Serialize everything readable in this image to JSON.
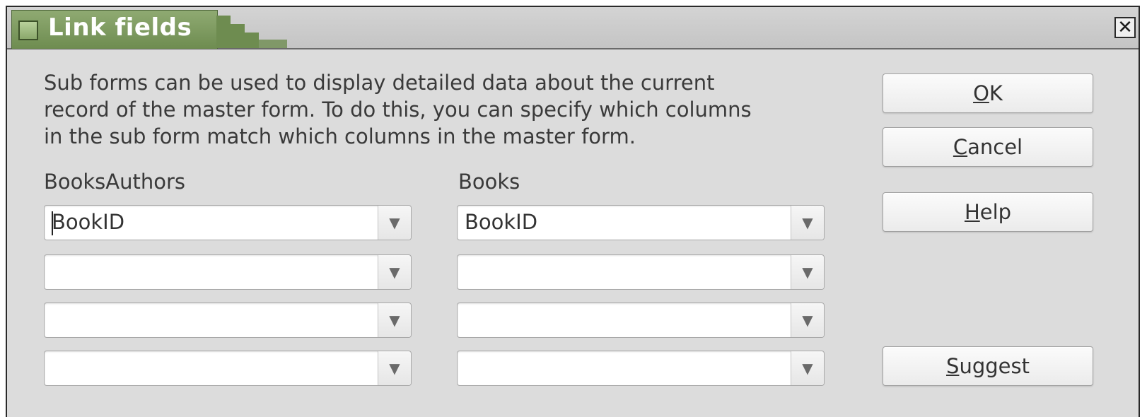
{
  "window": {
    "title": "Link fields",
    "close_glyph": "✕",
    "title_color": "#6e8c50"
  },
  "description": "Sub forms can be used to display detailed data about the current\nrecord of the master form. To do this, you can specify which columns\nin the sub form match which columns in the master form.",
  "columns": {
    "left_label": "BooksAuthors",
    "right_label": "Books"
  },
  "rows": [
    {
      "left": "BookID",
      "right": "BookID"
    },
    {
      "left": "",
      "right": ""
    },
    {
      "left": "",
      "right": ""
    },
    {
      "left": "",
      "right": ""
    }
  ],
  "buttons": {
    "ok": {
      "mnemonic": "O",
      "rest": "K"
    },
    "cancel": {
      "mnemonic": "C",
      "rest": "ancel"
    },
    "help": {
      "mnemonic": "H",
      "rest": "elp"
    },
    "suggest": {
      "mnemonic": "S",
      "rest": "uggest"
    }
  },
  "icons": {
    "dropdown_arrow": "▼"
  }
}
